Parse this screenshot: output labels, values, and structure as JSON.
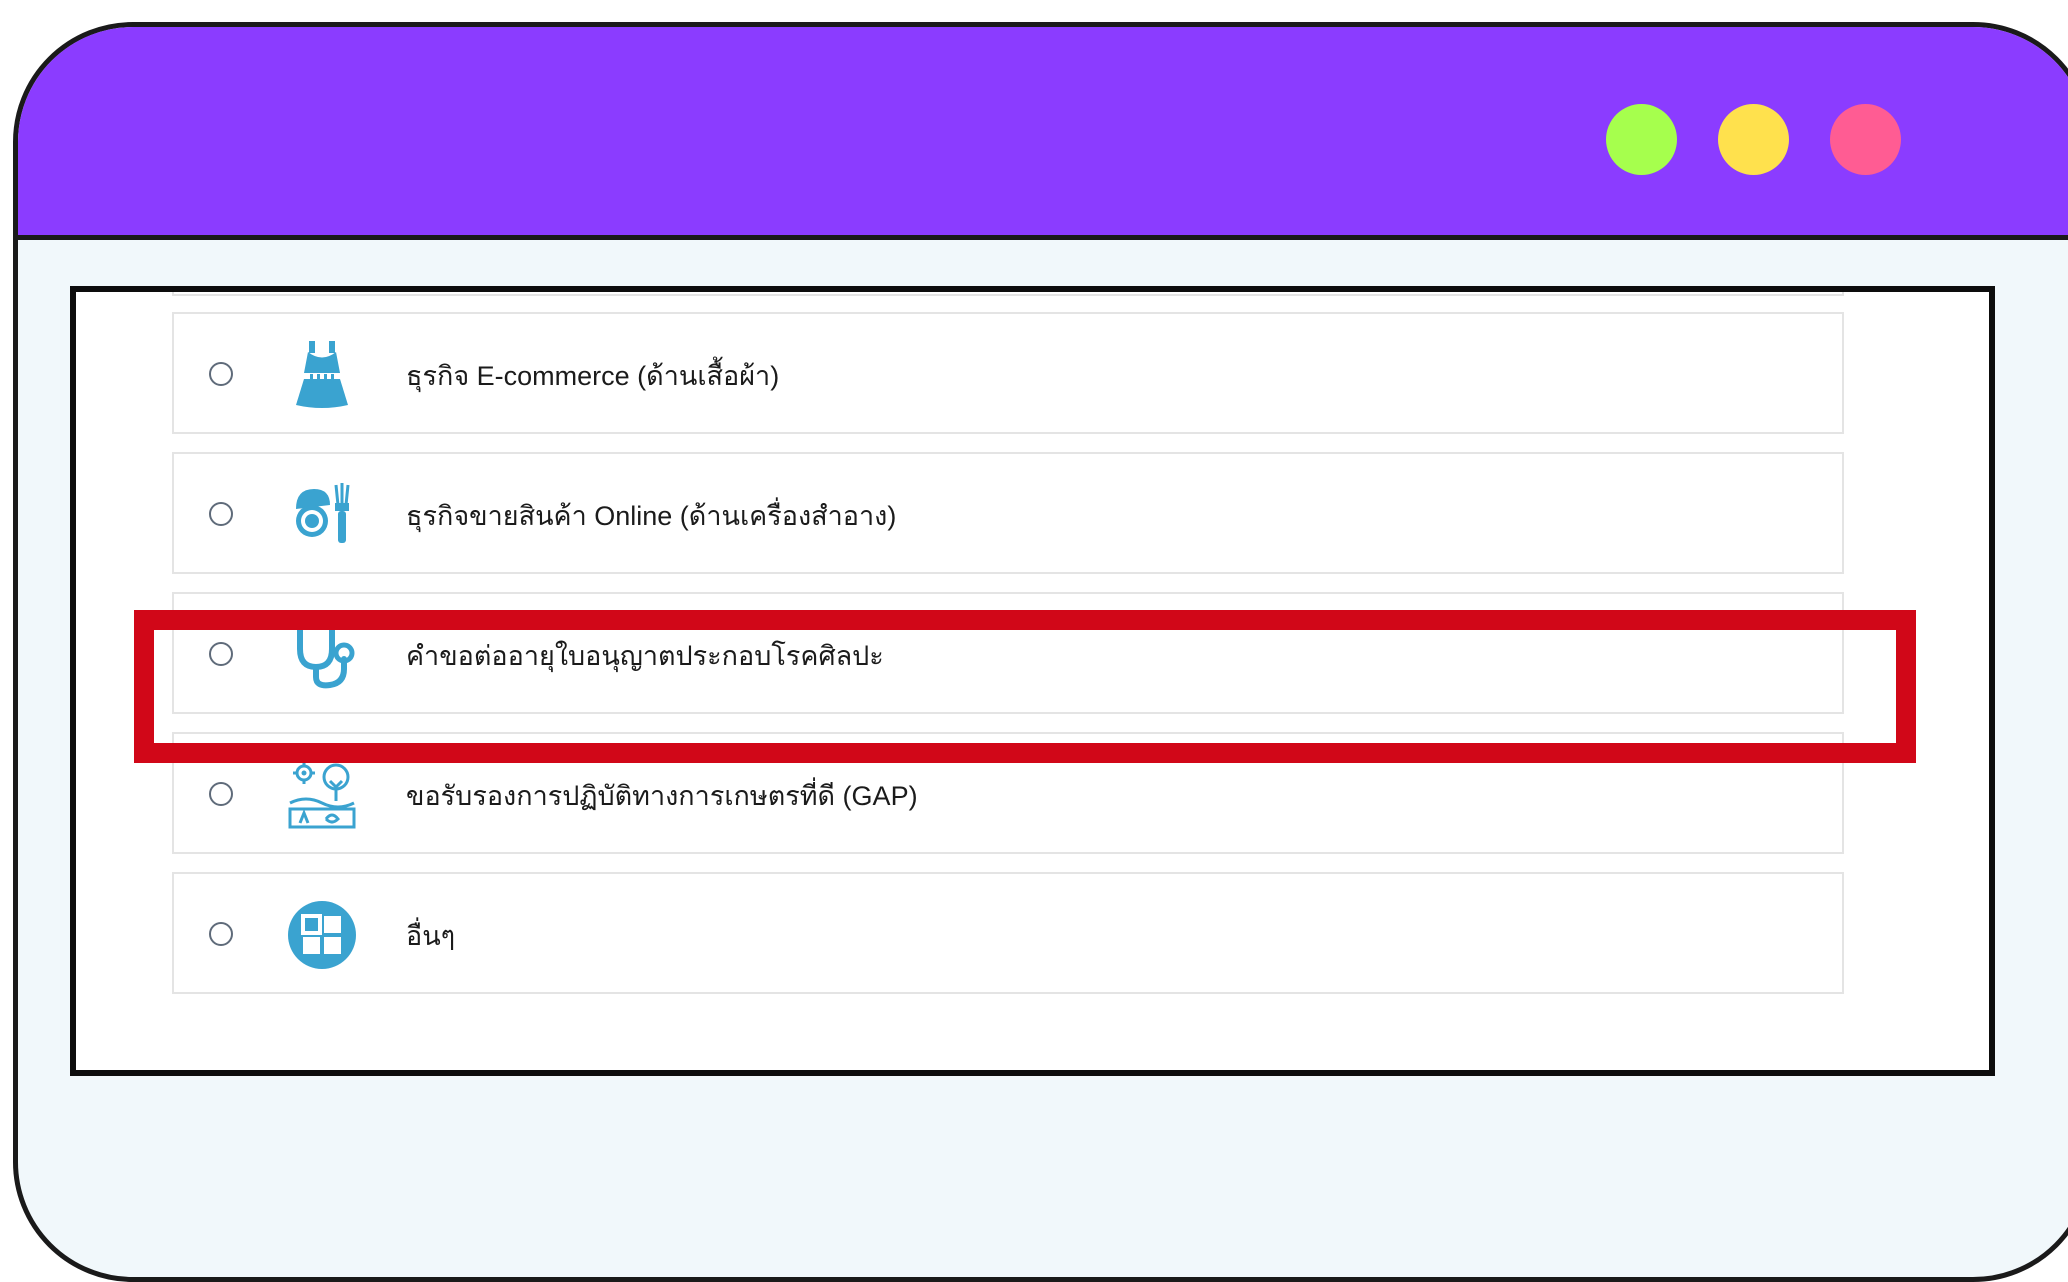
{
  "window": {
    "title_bar_color": "#8b3cff",
    "controls": [
      {
        "name": "green",
        "color": "#a6ff4d"
      },
      {
        "name": "yellow",
        "color": "#ffe14d"
      },
      {
        "name": "pink",
        "color": "#ff5c93"
      }
    ]
  },
  "options": [
    {
      "label": "ธุรกิจ E-commerce (ด้านเสื้อผ้า)",
      "icon": "dress-icon",
      "selected": false
    },
    {
      "label": "ธุรกิจขายสินค้า Online (ด้านเครื่องสำอาง)",
      "icon": "cosmetics-icon",
      "selected": false
    },
    {
      "label": "คำขอต่ออายุใบอนุญาตประกอบโรคศิลปะ",
      "icon": "stethoscope-icon",
      "selected": false,
      "highlighted": true
    },
    {
      "label": "ขอรับรองการปฏิบัติทางการเกษตรที่ดี (GAP)",
      "icon": "farm-icon",
      "selected": false
    },
    {
      "label": "อื่นๆ",
      "icon": "grid-icon",
      "selected": false
    }
  ],
  "highlight_color": "#d10718",
  "accent_icon_color": "#3aa3d0"
}
